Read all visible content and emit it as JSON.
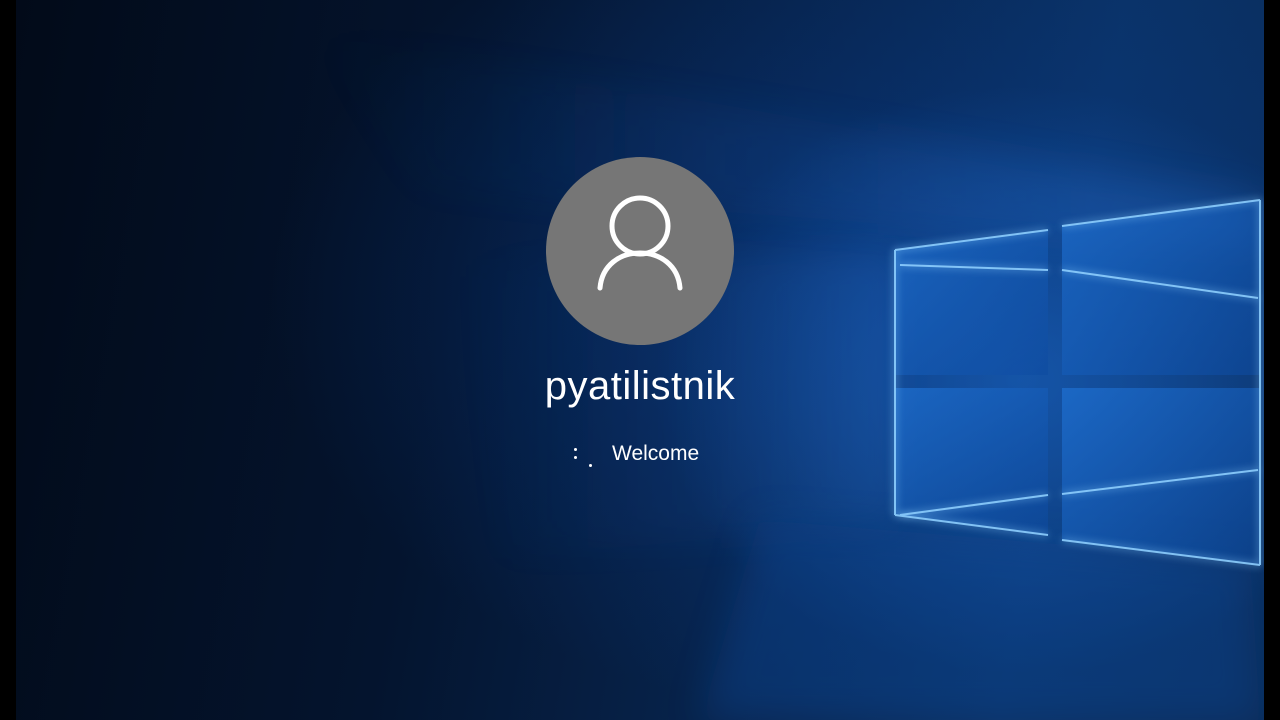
{
  "lock_screen": {
    "username": "pyatilistnik",
    "status": "Welcome"
  },
  "icons": {
    "avatar": "user-silhouette-icon",
    "spinner": "loading-dots-icon"
  },
  "colors": {
    "avatar_bg": "#767676",
    "text": "#ffffff",
    "accent_glow": "#2f8cff"
  }
}
